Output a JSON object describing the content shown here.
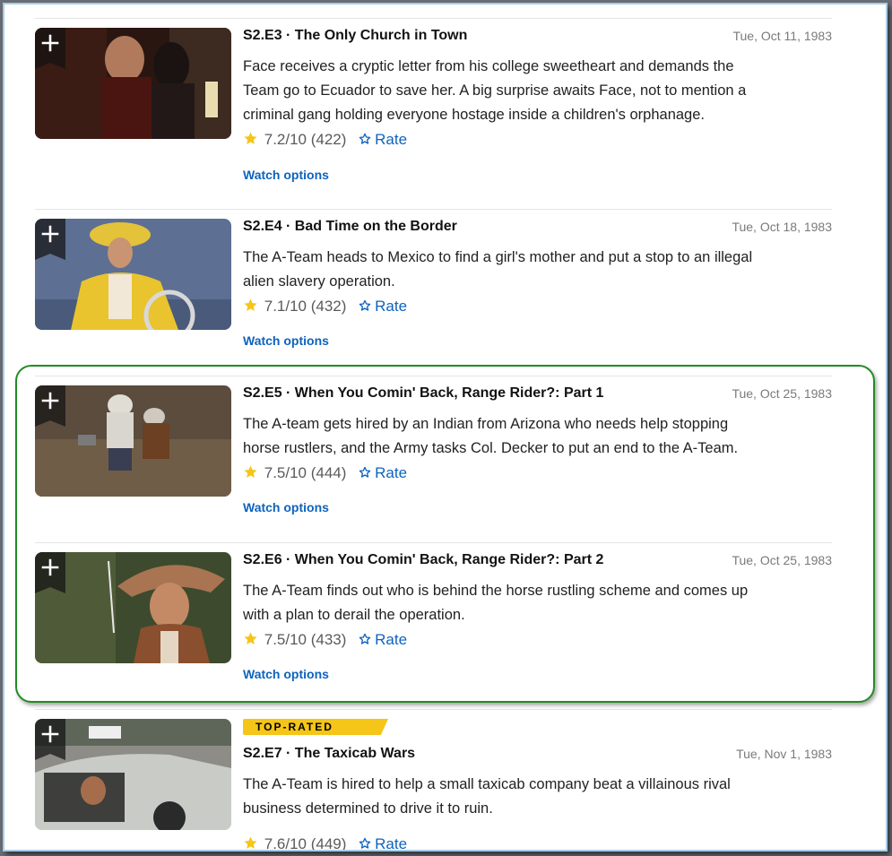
{
  "colors": {
    "accent_link": "#0e63be",
    "star": "#f5c518",
    "badge_bg": "#f5c518",
    "highlight_border": "#228b22"
  },
  "icons": {
    "add": "plus-icon",
    "star": "star-filled-icon",
    "rate": "star-outline-icon"
  },
  "episodes": [
    {
      "title": "S2.E3 · The Only Church in Town",
      "air_date": "Tue, Oct 11, 1983",
      "plot_lines": [
        "Face receives a cryptic letter from his college sweetheart and demands the",
        "Team go to Ecuador to save her. A big surprise awaits Face, not to mention a",
        "criminal gang holding everyone hostage inside a children's orphanage."
      ],
      "rating": "7.2/10",
      "votes": "(422)",
      "rate_label": "Rate",
      "watch_label": "Watch options"
    },
    {
      "title": "S2.E4 · Bad Time on the Border",
      "air_date": "Tue, Oct 18, 1983",
      "plot_lines": [
        "The A-Team heads to Mexico to find a girl's mother and put a stop to an illegal",
        "alien slavery operation."
      ],
      "rating": "7.1/10",
      "votes": "(432)",
      "rate_label": "Rate",
      "watch_label": "Watch options"
    },
    {
      "title": "S2.E5 · When You Comin' Back, Range Rider?: Part 1",
      "air_date": "Tue, Oct 25, 1983",
      "plot_lines": [
        "The A-team gets hired by an Indian from Arizona who needs help stopping",
        "horse rustlers, and the Army tasks Col. Decker to put an end to the A-Team."
      ],
      "rating": "7.5/10",
      "votes": "(444)",
      "rate_label": "Rate",
      "watch_label": "Watch options"
    },
    {
      "title": "S2.E6 · When You Comin' Back, Range Rider?: Part 2",
      "air_date": "Tue, Oct 25, 1983",
      "plot_lines": [
        "The A-Team finds out who is behind the horse rustling scheme and comes up",
        "with a plan to derail the operation."
      ],
      "rating": "7.5/10",
      "votes": "(433)",
      "rate_label": "Rate",
      "watch_label": "Watch options"
    },
    {
      "badge": "TOP-RATED",
      "title": "S2.E7 · The Taxicab Wars",
      "air_date": "Tue, Nov 1, 1983",
      "plot_lines": [
        "The A-Team is hired to help a small taxicab company beat a villainous rival",
        "business determined to drive it to ruin."
      ],
      "rating": "7.6/10",
      "votes": "(449)",
      "rate_label": "Rate"
    }
  ]
}
